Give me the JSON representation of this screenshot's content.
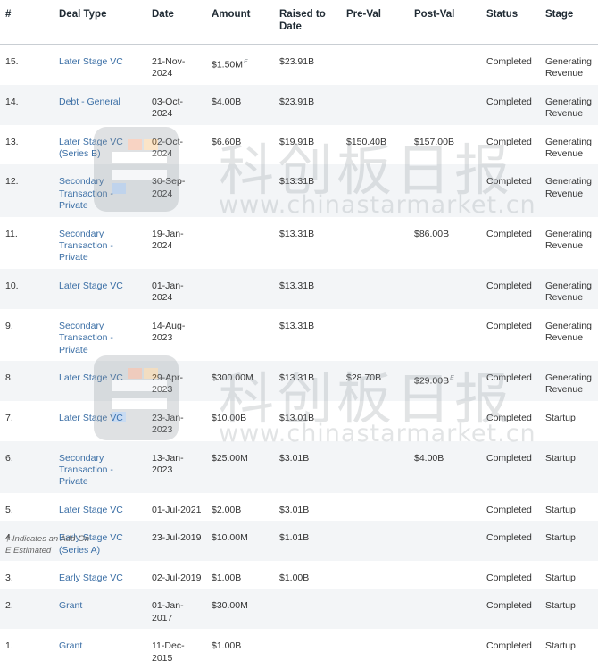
{
  "table": {
    "headers": [
      "#",
      "Deal Type",
      "Date",
      "Amount",
      "Raised to Date",
      "Pre-Val",
      "Post-Val",
      "Status",
      "Stage"
    ],
    "rows": [
      {
        "num": "15.",
        "type": "Later Stage VC",
        "date": "21-Nov-2024",
        "amount": "$1.50M",
        "amount_est": "E",
        "raised": "$23.91B",
        "pre": "",
        "post": "",
        "post_est": "",
        "status": "Completed",
        "stage": "Generating Revenue"
      },
      {
        "num": "14.",
        "type": "Debt - General",
        "date": "03-Oct-2024",
        "amount": "$4.00B",
        "amount_est": "",
        "raised": "$23.91B",
        "pre": "",
        "post": "",
        "post_est": "",
        "status": "Completed",
        "stage": "Generating Revenue"
      },
      {
        "num": "13.",
        "type": "Later Stage VC (Series B)",
        "date": "02-Oct-2024",
        "amount": "$6.60B",
        "amount_est": "",
        "raised": "$19.91B",
        "pre": "$150.40B",
        "post": "$157.00B",
        "post_est": "",
        "status": "Completed",
        "stage": "Generating Revenue"
      },
      {
        "num": "12.",
        "type": "Secondary Transaction - Private",
        "date": "30-Sep-2024",
        "amount": "",
        "amount_est": "",
        "raised": "$13.31B",
        "pre": "",
        "post": "",
        "post_est": "",
        "status": "Completed",
        "stage": "Generating Revenue"
      },
      {
        "num": "11.",
        "type": "Secondary Transaction - Private",
        "date": "19-Jan-2024",
        "amount": "",
        "amount_est": "",
        "raised": "$13.31B",
        "pre": "",
        "post": "$86.00B",
        "post_est": "",
        "status": "Completed",
        "stage": "Generating Revenue"
      },
      {
        "num": "10.",
        "type": "Later Stage VC",
        "date": "01-Jan-2024",
        "amount": "",
        "amount_est": "",
        "raised": "$13.31B",
        "pre": "",
        "post": "",
        "post_est": "",
        "status": "Completed",
        "stage": "Generating Revenue"
      },
      {
        "num": "9.",
        "type": "Secondary Transaction - Private",
        "date": "14-Aug-2023",
        "amount": "",
        "amount_est": "",
        "raised": "$13.31B",
        "pre": "",
        "post": "",
        "post_est": "",
        "status": "Completed",
        "stage": "Generating Revenue"
      },
      {
        "num": "8.",
        "type": "Later Stage VC",
        "date": "29-Apr-2023",
        "amount": "$300.00M",
        "amount_est": "",
        "raised": "$13.31B",
        "pre": "$28.70B",
        "post": "$29.00B",
        "post_est": "E",
        "status": "Completed",
        "stage": "Generating Revenue"
      },
      {
        "num": "7.",
        "type": "Later Stage VC",
        "date": "23-Jan-2023",
        "amount": "$10.00B",
        "amount_est": "",
        "raised": "$13.01B",
        "pre": "",
        "post": "",
        "post_est": "",
        "status": "Completed",
        "stage": "Startup"
      },
      {
        "num": "6.",
        "type": "Secondary Transaction - Private",
        "date": "13-Jan-2023",
        "amount": "$25.00M",
        "amount_est": "",
        "raised": "$3.01B",
        "pre": "",
        "post": "$4.00B",
        "post_est": "",
        "status": "Completed",
        "stage": "Startup"
      },
      {
        "num": "5.",
        "type": "Later Stage VC",
        "date": "01-Jul-2021",
        "amount": "$2.00B",
        "amount_est": "",
        "raised": "$3.01B",
        "pre": "",
        "post": "",
        "post_est": "",
        "status": "Completed",
        "stage": "Startup"
      },
      {
        "num": "4.",
        "type": "Early Stage VC (Series A)",
        "date": "23-Jul-2019",
        "amount": "$10.00M",
        "amount_est": "",
        "raised": "$1.01B",
        "pre": "",
        "post": "",
        "post_est": "",
        "status": "Completed",
        "stage": "Startup"
      },
      {
        "num": "3.",
        "type": "Early Stage VC",
        "date": "02-Jul-2019",
        "amount": "$1.00B",
        "amount_est": "",
        "raised": "$1.00B",
        "pre": "",
        "post": "",
        "post_est": "",
        "status": "Completed",
        "stage": "Startup"
      },
      {
        "num": "2.",
        "type": "Grant",
        "date": "01-Jan-2017",
        "amount": "$30.00M",
        "amount_est": "",
        "raised": "",
        "pre": "",
        "post": "",
        "post_est": "",
        "status": "Completed",
        "stage": "Startup"
      },
      {
        "num": "1.",
        "type": "Grant",
        "date": "11-Dec-2015",
        "amount": "$1.00B",
        "amount_est": "",
        "raised": "",
        "pre": "",
        "post": "",
        "post_est": "",
        "status": "Completed",
        "stage": "Startup"
      }
    ]
  },
  "footnotes": [
    "† Indicates an Add-On",
    "E Estimated"
  ],
  "watermark": {
    "text_cn": "科创板日报",
    "url": "www.chinastarmarket.cn"
  },
  "colors": {
    "link": "#3a6ea5",
    "row_alt": "#f3f5f7",
    "header_rule": "#c9ced3"
  }
}
